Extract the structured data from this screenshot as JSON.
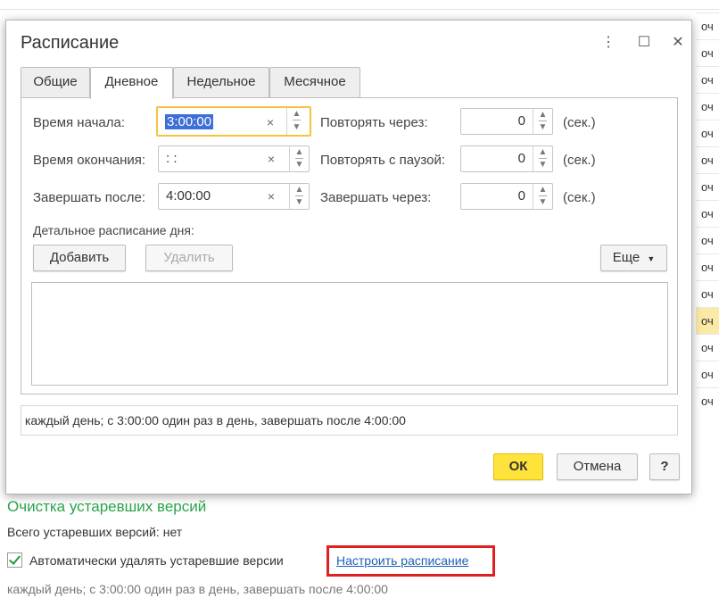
{
  "background": {
    "right_column_cells": [
      "оч",
      "оч",
      "оч",
      "оч",
      "оч",
      "оч",
      "оч",
      "оч",
      "оч",
      "оч",
      "оч",
      "оч",
      "оч",
      "оч",
      "оч"
    ],
    "highlighted_row_index": 11,
    "highlight_color": "#fbe9a6"
  },
  "dialog": {
    "title": "Расписание",
    "controls": {
      "more": "⋮",
      "maximize": "☐",
      "close": "✕"
    },
    "tabs": [
      {
        "label": "Общие",
        "active": false
      },
      {
        "label": "Дневное",
        "active": true
      },
      {
        "label": "Недельное",
        "active": false
      },
      {
        "label": "Месячное",
        "active": false
      }
    ],
    "fields": {
      "start_time": {
        "label": "Время начала:",
        "value": "3:00:00"
      },
      "end_time": {
        "label": "Время окончания:",
        "value": " :  :"
      },
      "finish_after": {
        "label": "Завершать после:",
        "value": "4:00:00"
      },
      "repeat_every": {
        "label": "Повторять через:",
        "value": "0",
        "unit": "(сек.)"
      },
      "repeat_pause": {
        "label": "Повторять с паузой:",
        "value": "0",
        "unit": "(сек.)"
      },
      "finish_in": {
        "label": "Завершать через:",
        "value": "0",
        "unit": "(сек.)"
      }
    },
    "detail_label": "Детальное расписание дня:",
    "add_button": "Добавить",
    "delete_button": "Удалить",
    "more_button": "Еще",
    "summary": "каждый день; с 3:00:00 один раз в день, завершать после 4:00:00",
    "ok_button": "ОК",
    "cancel_button": "Отмена",
    "help_button": "?",
    "focus_color": "#f5c242",
    "ok_color": "#ffe33d"
  },
  "page": {
    "section_title": "Очистка устаревших версий",
    "total_obsolete": "Всего устаревших версий: нет",
    "auto_delete_label": "Автоматически удалять устаревшие версии",
    "auto_delete_checked": true,
    "configure_link": "Настроить расписание",
    "schedule_text": "каждый день; с 3:00:00 один раз в день, завершать после 4:00:00",
    "accent_green": "#2aa34a",
    "highlight_red": "#e02020"
  }
}
